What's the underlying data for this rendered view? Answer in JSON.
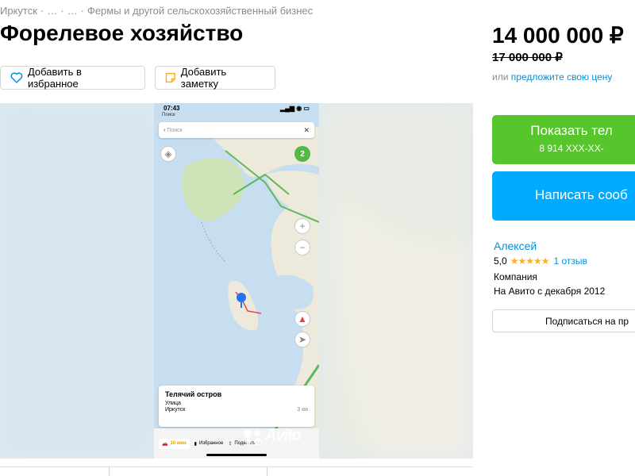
{
  "breadcrumbs": [
    "Иркутск",
    "…",
    "…",
    "Фермы и другой сельскохозяйственный бизнес"
  ],
  "title": "Форелевое хозяйство",
  "actions": {
    "favorite_label": "Добавить в избранное",
    "note_label": "Добавить заметку"
  },
  "price": {
    "current": "14 000 000 ₽",
    "old": "17 000 000 ₽",
    "offer_prefix": "или",
    "offer_link": "предложите свою цену"
  },
  "contact": {
    "show_phone_label": "Показать тел",
    "phone_masked": "8 914 XXX-XX-",
    "write_label": "Написать сооб"
  },
  "seller": {
    "name": "Алексей",
    "rating": "5,0",
    "stars": "★★★★★",
    "reviews": "1 отзыв",
    "type": "Компания",
    "since": "На Авито с декабря 2012",
    "subscribe_label": "Подписаться на пр"
  },
  "screenshot": {
    "time": "07:43",
    "back_label": "Поиск",
    "search_placeholder": "Поиск",
    "layers_badge": "2",
    "place_name": "Телячий остров",
    "place_type": "Улица",
    "place_city": "Иркутск",
    "place_distance": "3 км",
    "route_time": "10 мин",
    "bookmark_label": "Избранное",
    "share_label": "Поделиться"
  },
  "watermark": "Avito",
  "colors": {
    "green_button": "#57c52c",
    "blue_button": "#00aaff",
    "link": "#0091d9",
    "star": "#ffb021"
  }
}
